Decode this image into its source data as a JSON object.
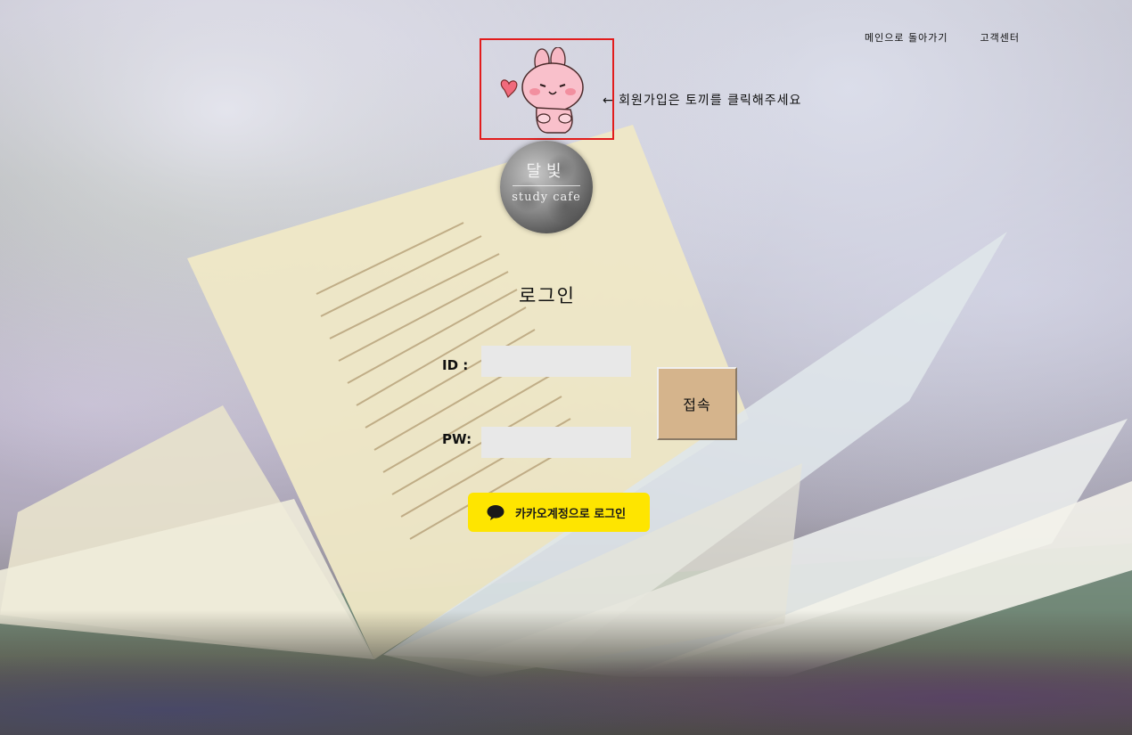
{
  "nav": {
    "main_link": "메인으로 돌아가기",
    "support_link": "고객센터"
  },
  "signup": {
    "hint": "← 회원가입은 토끼를 클릭해주세요"
  },
  "logo": {
    "title": "달빛",
    "subtitle": "study cafe"
  },
  "login": {
    "title": "로그인",
    "id_label": "ID :",
    "pw_label": "PW:",
    "submit_label": "접속",
    "kakao_label": "카카오계정으로 로그인"
  },
  "colors": {
    "highlight_border": "#e21c1c",
    "submit_bg": "#d5b48c",
    "kakao_bg": "#fee500"
  },
  "icons": {
    "rabbit": "rabbit-character-icon",
    "heart": "heart-icon",
    "kakao": "speech-bubble-icon"
  }
}
